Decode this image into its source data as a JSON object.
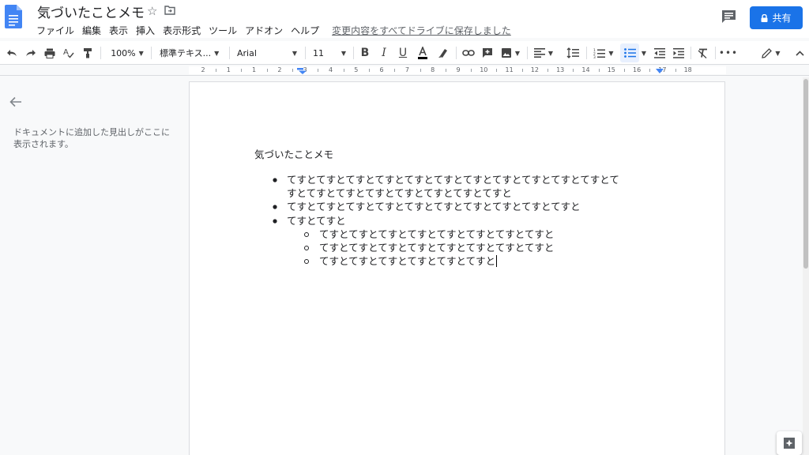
{
  "header": {
    "title": "気づいたことメモ",
    "menu": [
      "ファイル",
      "編集",
      "表示",
      "挿入",
      "表示形式",
      "ツール",
      "アドオン",
      "ヘルプ"
    ],
    "save_status": "変更内容をすべてドライブに保存しました",
    "share_label": "共有"
  },
  "toolbar": {
    "zoom": "100%",
    "style": "標準テキス...",
    "font": "Arial",
    "font_size": "11"
  },
  "ruler": {
    "numbers": [
      "2",
      "1",
      "1",
      "2",
      "3",
      "4",
      "5",
      "6",
      "7",
      "8",
      "9",
      "10",
      "11",
      "12",
      "13",
      "14",
      "15",
      "16",
      "17",
      "18"
    ]
  },
  "outline": {
    "hint": "ドキュメントに追加した見出しがここに表示されます。"
  },
  "document": {
    "heading": "気づいたことメモ",
    "items": [
      {
        "level": 1,
        "text": "てすとてすとてすとてすとてすとてすとてすとてすとてすとてすとてすとて"
      },
      {
        "level": 1,
        "text": "すとてすとてすとてすとてすとてすとてすとてすと",
        "continuation": true
      },
      {
        "level": 1,
        "text": "てすとてすとてすとてすとてすとてすとてすとてすとてすとてすと"
      },
      {
        "level": 1,
        "text": "てすとてすと"
      },
      {
        "level": 2,
        "text": "てすとてすとてすとてすとてすとてすとてすとてすと"
      },
      {
        "level": 2,
        "text": "てすとてすとてすとてすとてすとてすとてすとてすと"
      },
      {
        "level": 2,
        "text": "てすとてすとてすとてすとてすとてすと"
      }
    ]
  },
  "colors": {
    "accent": "#1a73e8",
    "doc_icon": "#4285f4",
    "text": "#202124",
    "muted": "#5f6368"
  }
}
